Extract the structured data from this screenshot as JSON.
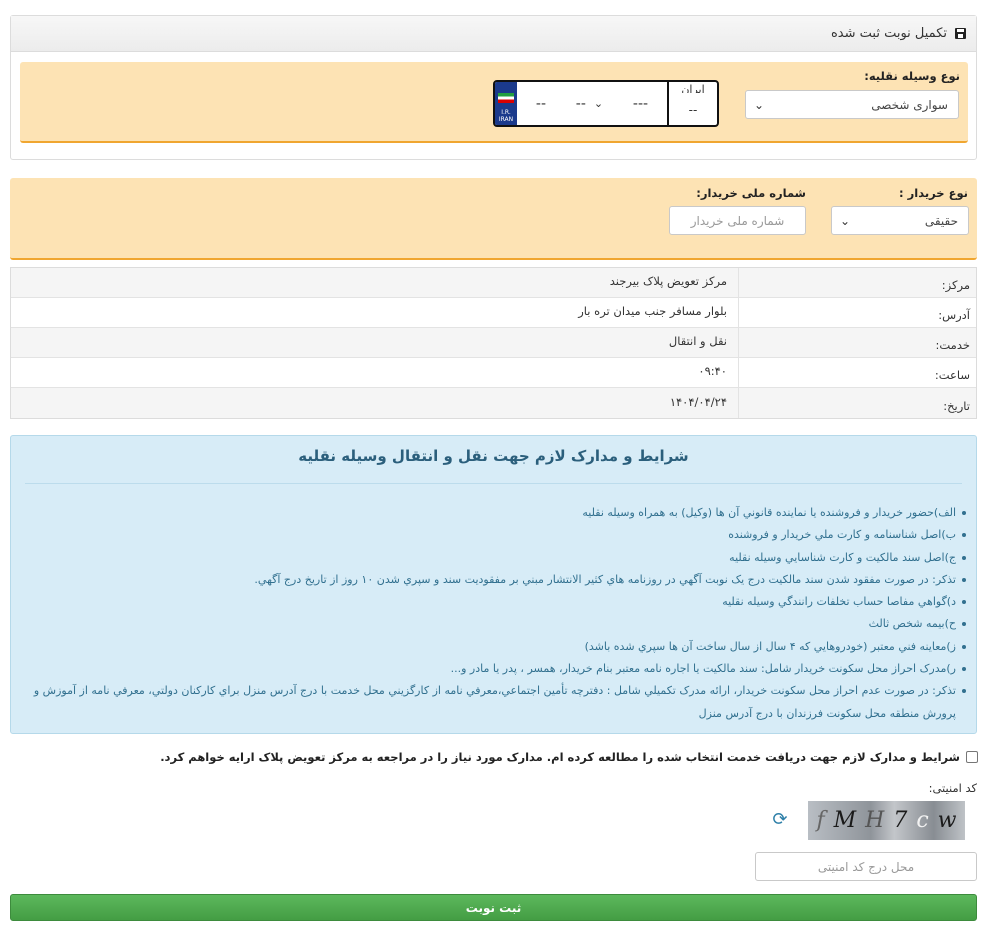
{
  "panel": {
    "title": "تکمیل نوبت ثبت شده"
  },
  "vehicle": {
    "label": "نوع وسیله نقلیه:",
    "selected": "سواری شخصی"
  },
  "plate": {
    "iran_text": "ایران",
    "iran_value": "--",
    "part3": "---",
    "letter": "--",
    "part1": "--",
    "flag_text1": "I.R.",
    "flag_text2": "IRAN"
  },
  "buyer": {
    "type_label": "نوع خریدار :",
    "type_selected": "حقیقی",
    "national_id_label": "شماره ملی خریدار:",
    "national_id_placeholder": "شماره ملی خریدار"
  },
  "info": [
    {
      "key": "مرکز:",
      "value": "مرکز تعویض پلاک بیرجند"
    },
    {
      "key": "آدرس:",
      "value": "بلوار مسافر جنب میدان تره بار"
    },
    {
      "key": "خدمت:",
      "value": "نقل و انتقال"
    },
    {
      "key": "ساعت:",
      "value": "۰۹:۴۰"
    },
    {
      "key": "تاریخ:",
      "value": "۱۴۰۴/۰۴/۲۴"
    }
  ],
  "terms": {
    "title": "شرایط و مدارک لازم جهت نقل و انتقال وسیله نقلیه",
    "items": [
      "الف)حضور خريدار و فروشنده يا نماينده قانوني آن ها (وکيل) به همراه وسيله نقليه",
      "ب)اصل شناسنامه و کارت ملي خريدار و فروشنده",
      "ج)اصل سند مالکيت و کارت شناسايي وسيله نقليه",
      "تذکر: در صورت مفقود شدن سند مالکيت درج يک نوبت آگهي در روزنامه هاي کثير الانتشار مبني بر مفقوديت سند و سپري شدن ۱۰ روز از تاريخ درج آگهي.",
      "د)گواهي مفاصا حساب تخلفات رانندگي وسيله نقليه",
      "ح)بیمه شخص ثالث",
      "ز)معاينه فني معتبر (خودروهايي که ۴ سال از سال ساخت آن ها سپري شده باشد)",
      "ر)مدرک احراز محل سکونت خريدار شامل: سند مالکيت يا اجاره نامه معتبر بنام خريدار، همسر ، پدر يا مادر و...",
      "تذکر: در صورت عدم احراز محل سکونت خريدار، ارائه مدرک تکميلي شامل : دفترچه تأمين اجتماعي،معرفي نامه از کارگزيني محل خدمت با درج آدرس منزل براي کارکنان دولتي، معرفي نامه از آموزش و پرورش منطقه محل سکونت فرزندان با درج آدرس منزل"
    ]
  },
  "agree": {
    "text": "شرایط و مدارک لازم جهت دریافت خدمت انتخاب شده را مطالعه کرده ام. مدارک مورد نیاز را در مراجعه به مرکز تعویض پلاک ارایه خواهم کرد."
  },
  "captcha": {
    "label": "کد امنیتی:",
    "chars": [
      "f",
      "M",
      "H",
      "7",
      "c",
      "w"
    ],
    "placeholder": "محل درج کد امنیتی"
  },
  "submit": {
    "label": "ثبت نوبت"
  },
  "colors": {
    "accent": "#f0a630",
    "success": "#5cb85c",
    "info_bg": "#d7ecf7"
  }
}
